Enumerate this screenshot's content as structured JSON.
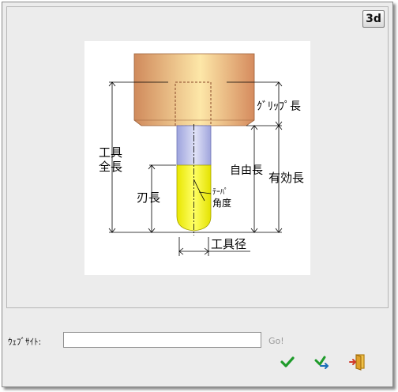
{
  "view_toggle": {
    "label": "3d"
  },
  "diagram": {
    "labels": {
      "grip_length": "ｸﾞﾘｯﾌﾟ長",
      "tool_length_1": "工具",
      "tool_length_2": "全長",
      "free_length": "自由長",
      "effective_length": "有効長",
      "cutting_length": "刃長",
      "taper_angle_1": "ﾃｰﾊﾟ",
      "taper_angle_2": "角度",
      "tool_diameter": "工具径"
    },
    "colors": {
      "holder": "#e3a26f",
      "shank": "#bcc0ea",
      "blade": "#ffff00"
    }
  },
  "website": {
    "label": "ｳｪﾌﾞｻｲﾄ:",
    "value": "",
    "go_label": "Go!"
  },
  "actions": {
    "ok_icon": "green-check-icon",
    "apply_icon": "check-arrow-icon",
    "exit_icon": "exit-door-icon"
  }
}
